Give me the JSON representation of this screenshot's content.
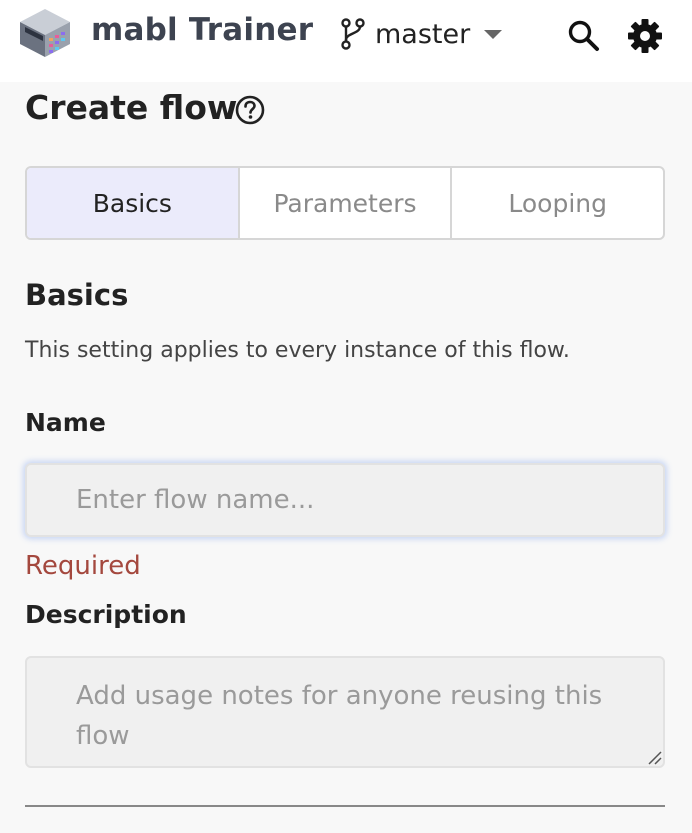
{
  "header": {
    "app_title": "mabl Trainer",
    "branch": "master",
    "logo_icon": "mabl-logo",
    "branch_icon": "git-branch-icon",
    "search_icon": "search-icon",
    "settings_icon": "gear-icon"
  },
  "page": {
    "title": "Create flow",
    "help_icon": "help-circle-icon"
  },
  "tabs": [
    {
      "label": "Basics",
      "active": true
    },
    {
      "label": "Parameters",
      "active": false
    },
    {
      "label": "Looping",
      "active": false
    }
  ],
  "basics": {
    "section_title": "Basics",
    "description": "This setting applies to every instance of this flow.",
    "name_label": "Name",
    "name_placeholder": "Enter flow name...",
    "name_value": "",
    "required_text": "Required",
    "description_label": "Description",
    "description_placeholder": "Add usage notes for anyone reusing this flow",
    "description_value": ""
  },
  "colors": {
    "active_tab_bg": "#ebebfb",
    "error": "#a4483e",
    "header_bg": "#ffffff",
    "page_bg": "#f8f8f8"
  }
}
